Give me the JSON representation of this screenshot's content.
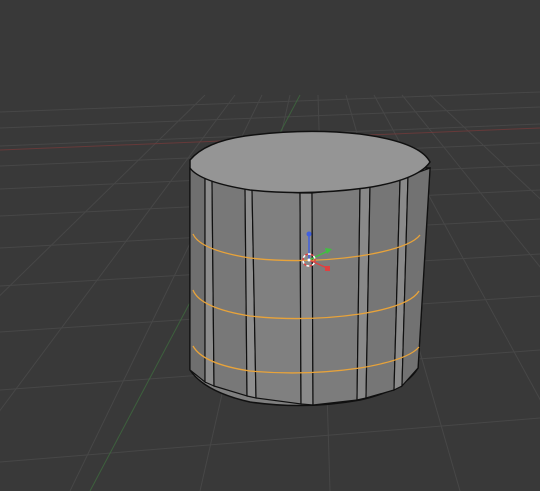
{
  "viewport": {
    "background_color": "#393939",
    "grid_color": "#474747",
    "x_axis_color": "#7a3a3a",
    "y_axis_color": "#3f6a3f"
  },
  "mesh": {
    "object_type": "cylinder",
    "face_count": 16,
    "edge_loop_count": 3,
    "side_color": "#7f7f7f",
    "top_color": "#959595",
    "edge_color": "#101010",
    "edge_loop_color": "#e8a33a"
  },
  "gizmo": {
    "icon": "3d-cursor-icon",
    "axis_colors": {
      "x": "#e04040",
      "y": "#40c040",
      "z": "#4060e0"
    }
  }
}
